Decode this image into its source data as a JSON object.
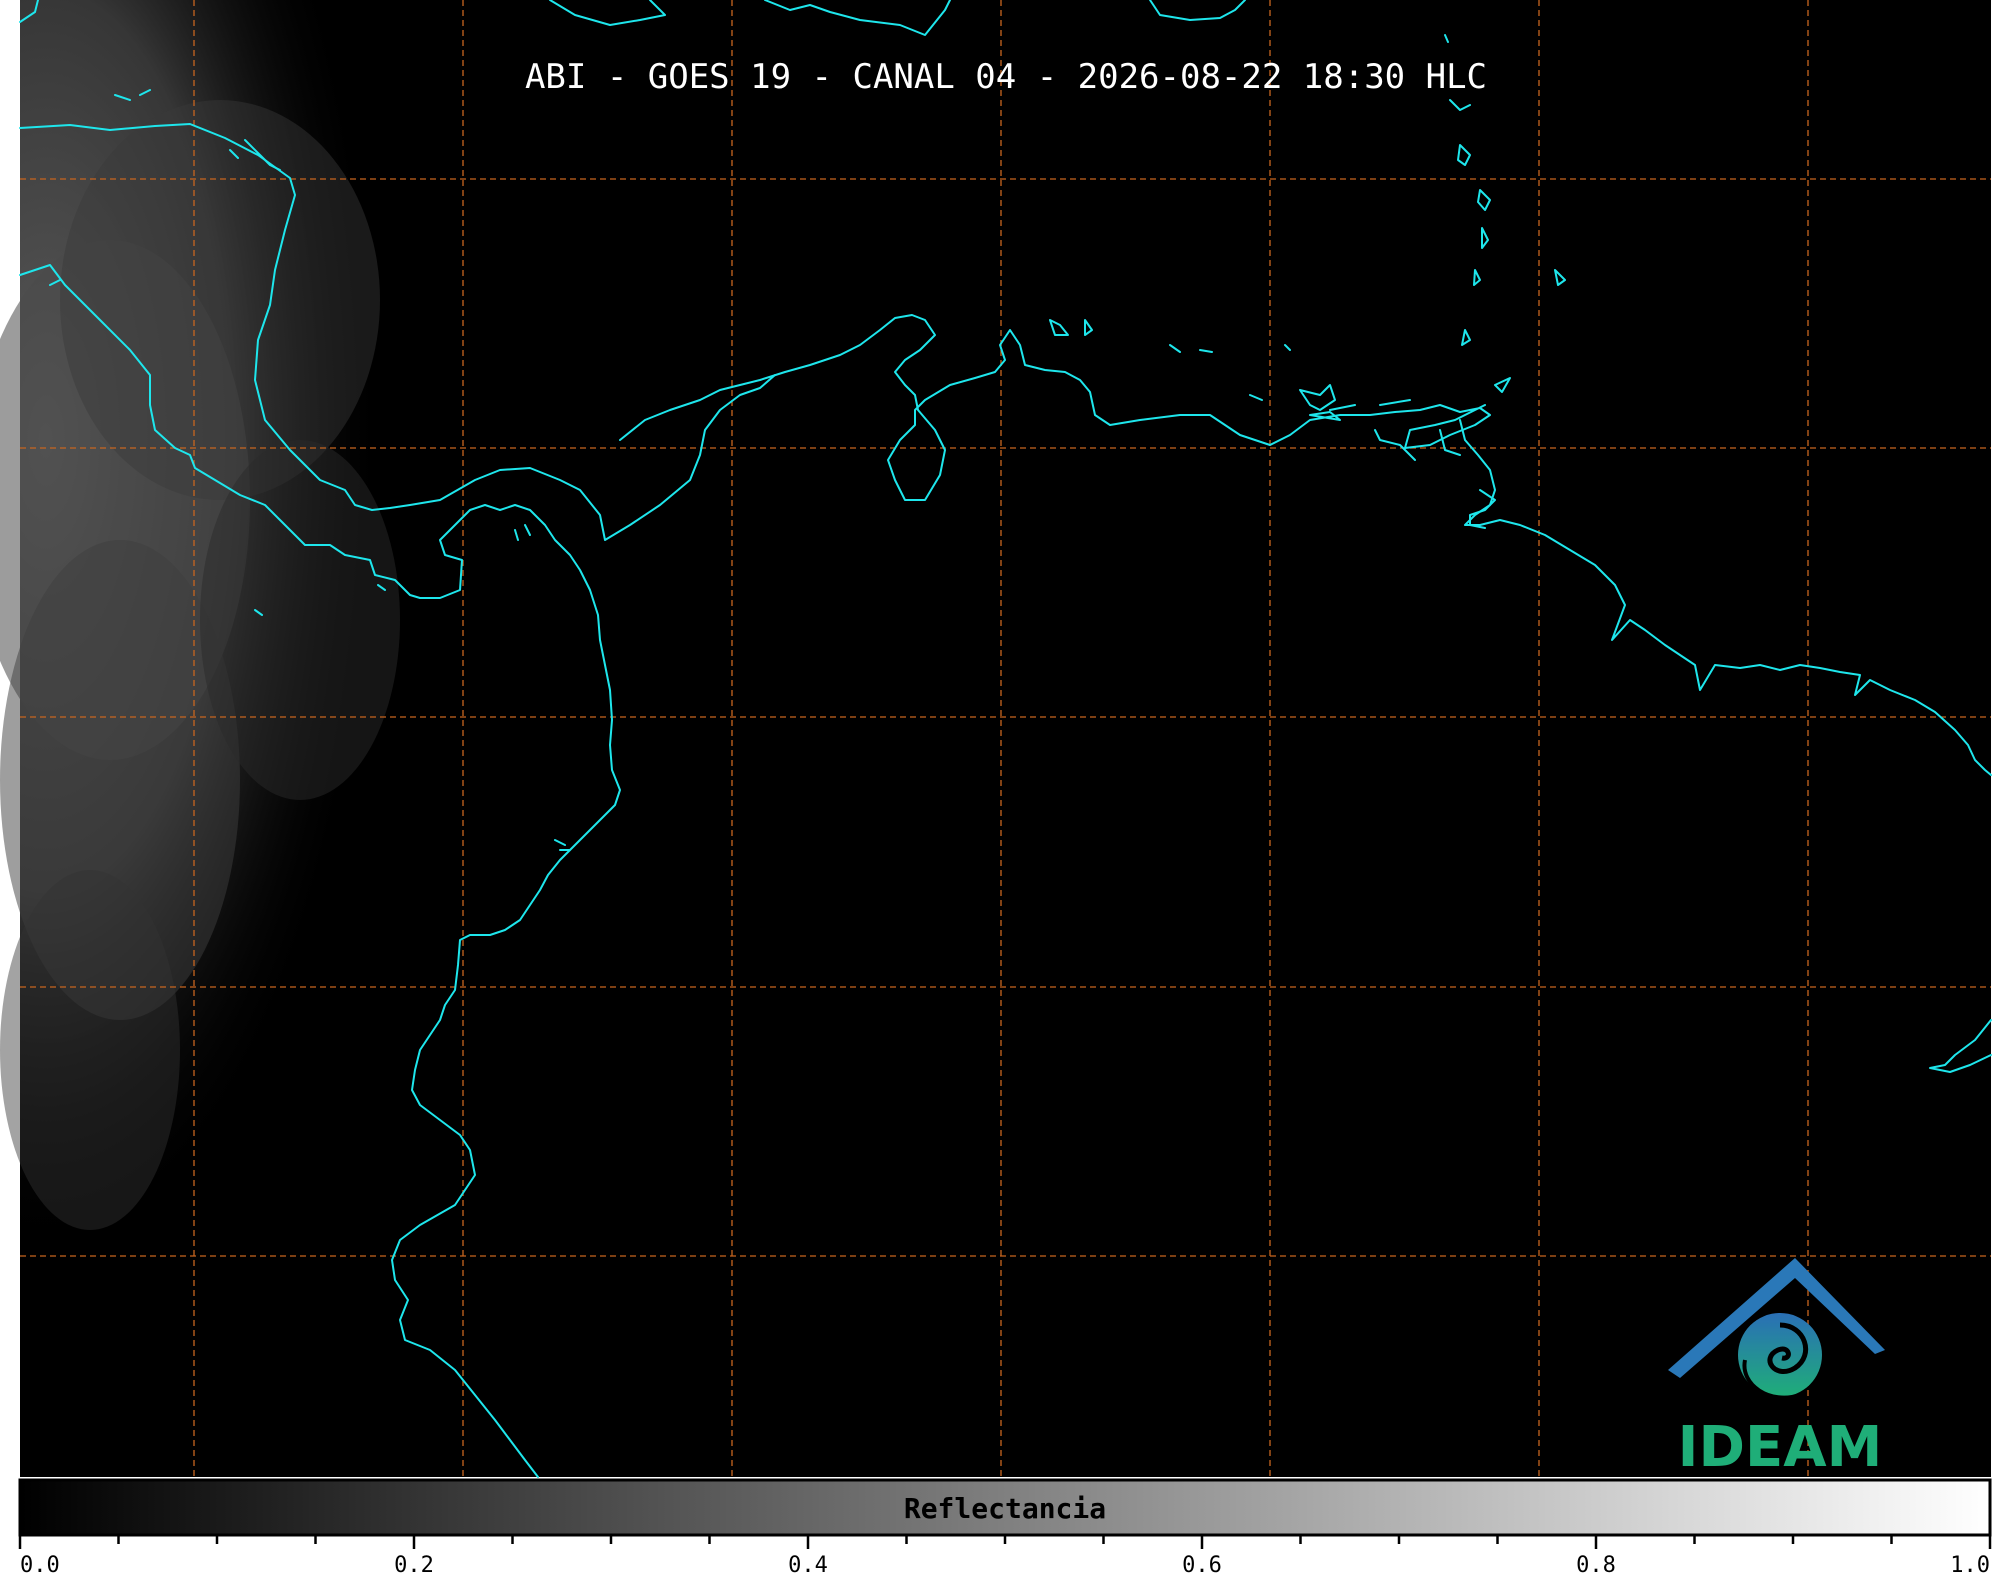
{
  "title": "ABI - GOES 19 - CANAL 04 - 2026-08-22 18:30 HLC",
  "colorbar": {
    "label": "Reflectancia",
    "min": 0.0,
    "max": 1.0,
    "tick_labels": [
      "0.0",
      "0.2",
      "0.4",
      "0.6",
      "0.8",
      "1.0"
    ],
    "major_step": 0.2,
    "minor_step": 0.05
  },
  "logo": {
    "text": "IDEAM"
  },
  "colors": {
    "background": "#000000",
    "coastline": "#1ee6ec",
    "graticule": "#c8651f",
    "logo_green": "#1fae78",
    "logo_blue": "#2a78b8"
  },
  "map": {
    "graticule_style": "dashed",
    "coastline_style": "solid"
  }
}
